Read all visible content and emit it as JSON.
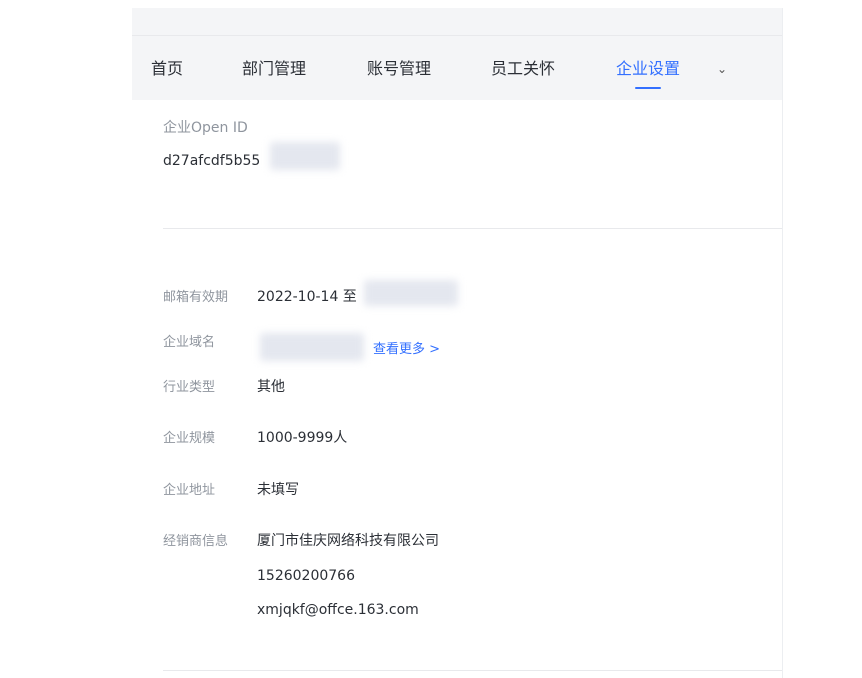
{
  "nav": {
    "items": [
      {
        "label": "首页"
      },
      {
        "label": "部门管理"
      },
      {
        "label": "账号管理"
      },
      {
        "label": "员工关怀"
      },
      {
        "label": "企业设置",
        "active": true
      }
    ],
    "more_icon": "chevron-down-icon",
    "more_glyph": "⌄"
  },
  "openid": {
    "label": "企业Open ID",
    "value": "d27afcdf5b55"
  },
  "info": {
    "mail_validity": {
      "label": "邮箱有效期",
      "value": "2022-10-14 至"
    },
    "domain": {
      "label": "企业域名",
      "link": "查看更多 >"
    },
    "industry": {
      "label": "行业类型",
      "value": "其他"
    },
    "scale": {
      "label": "企业规模",
      "value": "1000-9999人"
    },
    "address": {
      "label": "企业地址",
      "value": "未填写"
    },
    "dealer": {
      "label": "经销商信息",
      "company": "厦门市佳庆网络科技有限公司",
      "phone": "15260200766",
      "email": "xmjqkf@offce.163.com"
    }
  },
  "colors": {
    "accent": "#3370ff",
    "label": "#8f959e",
    "text": "#2b2f36",
    "nav_bg": "#f4f5f7"
  }
}
